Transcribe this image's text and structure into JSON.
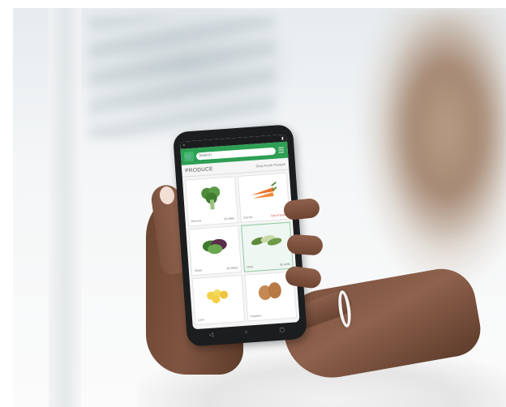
{
  "app": {
    "search_placeholder": "Search",
    "section_title": "PRODUCE",
    "section_link": "Shop Fresh Produce"
  },
  "products": [
    {
      "name": "Broccoli",
      "price": "$1.99/lb",
      "sale": false,
      "icon": "broccoli-icon"
    },
    {
      "name": "Carrots",
      "price": "Out of Stock",
      "sale": true,
      "icon": "carrot-icon"
    },
    {
      "name": "Salad",
      "price": "$2.99/ea",
      "sale": false,
      "icon": "salad-icon"
    },
    {
      "name": "Okra",
      "price": "$3.49/lb",
      "sale": false,
      "icon": "okra-icon"
    },
    {
      "name": "Corn",
      "price": "",
      "sale": false,
      "icon": "corn-icon"
    },
    {
      "name": "Potatoes",
      "price": "",
      "sale": false,
      "icon": "potato-icon"
    }
  ],
  "icons": {
    "logo": "cart-logo-icon",
    "menu": "hamburger-menu-icon",
    "nav_back": "back-triangle-icon",
    "nav_home": "home-circle-icon",
    "nav_recent": "recent-square-icon"
  },
  "colors": {
    "header_green": "#2e9e54",
    "selected_border": "#8fcaa4",
    "sale_red": "#d04040"
  }
}
